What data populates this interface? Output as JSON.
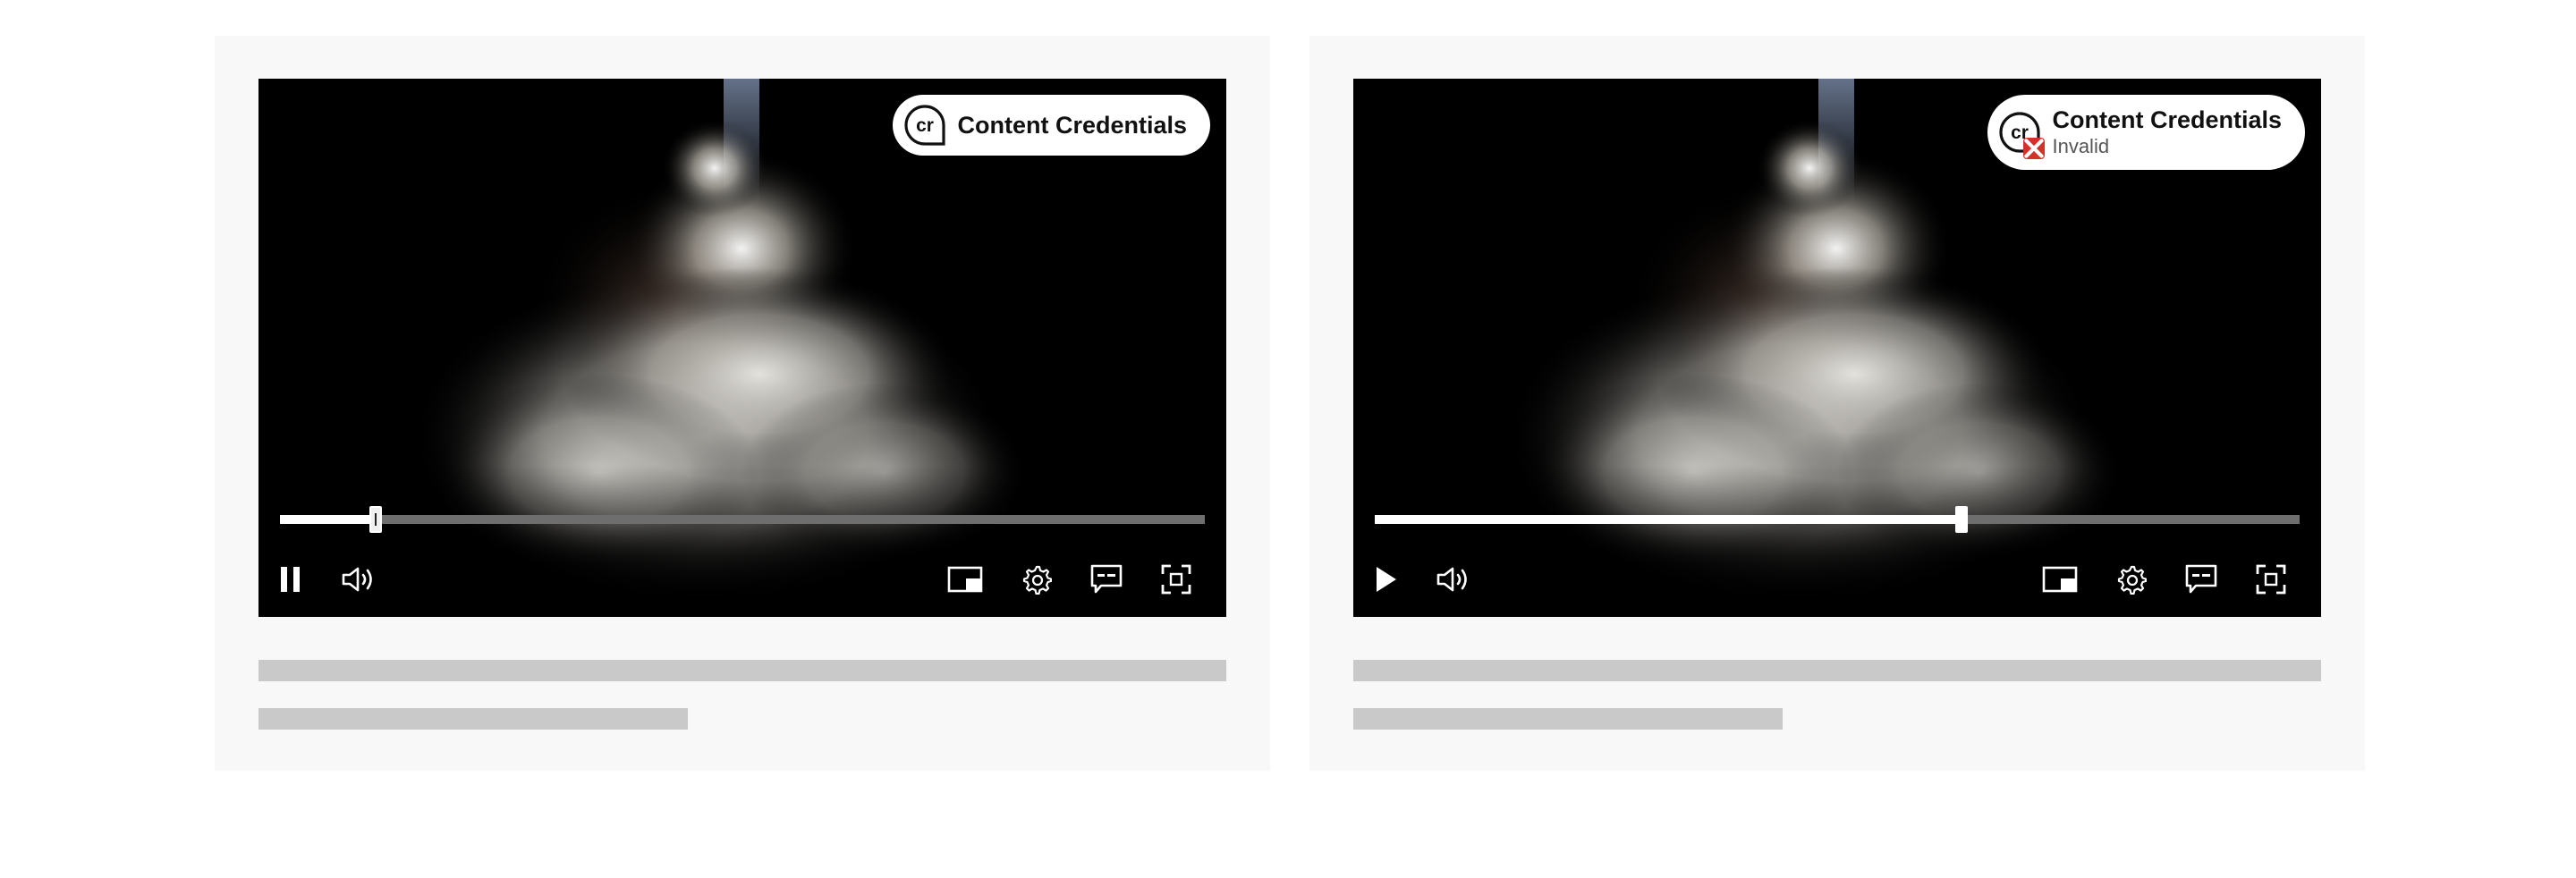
{
  "players": [
    {
      "credential": {
        "title": "Content Credentials",
        "status": ""
      },
      "playback": {
        "state": "playing",
        "progress": 0.103
      },
      "controls": [
        "pause-icon",
        "volume-icon",
        "picture-in-picture-icon",
        "settings-icon",
        "captions-icon",
        "fullscreen-icon"
      ]
    },
    {
      "credential": {
        "title": "Content Credentials",
        "status": "Invalid"
      },
      "playback": {
        "state": "paused",
        "progress": 0.634
      },
      "controls": [
        "play-icon",
        "volume-icon",
        "picture-in-picture-icon",
        "settings-icon",
        "captions-icon",
        "fullscreen-icon"
      ]
    }
  ],
  "colors": {
    "card_background": "#f8f8f8",
    "video_background": "#000000",
    "progress_track": "#6e6e6e",
    "progress_fill": "#ffffff",
    "invalid_badge": "#d3312a",
    "skeleton": "#c9c9c9"
  }
}
